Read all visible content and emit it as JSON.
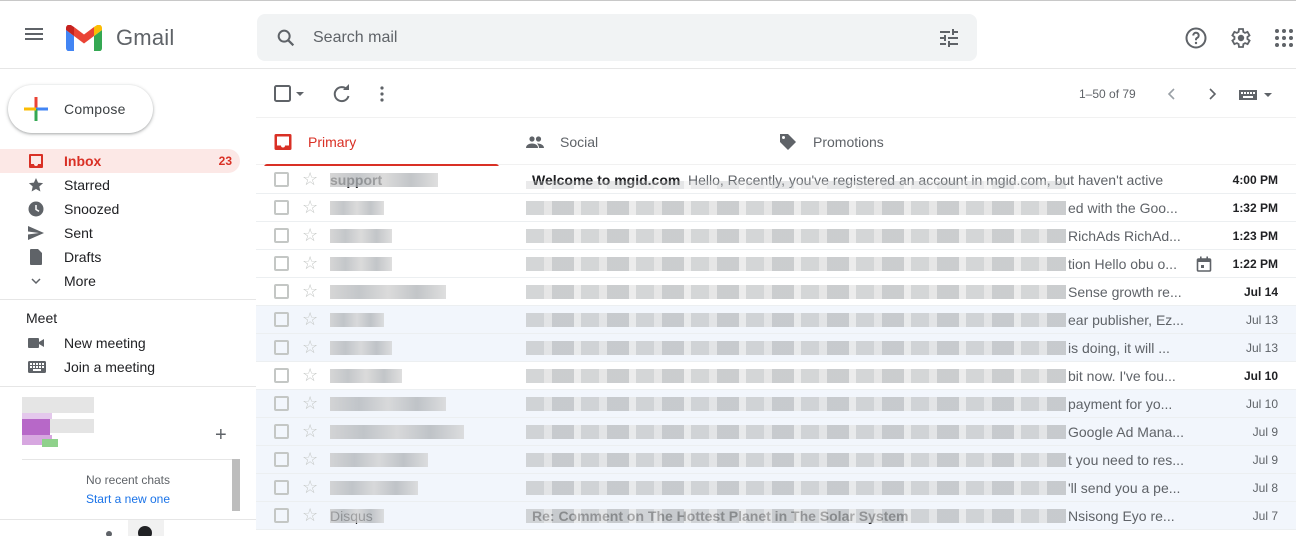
{
  "app": {
    "name": "Gmail"
  },
  "search": {
    "placeholder": "Search mail",
    "value": ""
  },
  "header_icons": [
    "help-icon",
    "settings-icon",
    "apps-icon"
  ],
  "compose": {
    "label": "Compose"
  },
  "nav": [
    {
      "label": "Inbox",
      "count": "23",
      "icon": "inbox-icon",
      "active": true
    },
    {
      "label": "Starred",
      "icon": "star-icon"
    },
    {
      "label": "Snoozed",
      "icon": "clock-icon"
    },
    {
      "label": "Sent",
      "icon": "send-icon"
    },
    {
      "label": "Drafts",
      "icon": "draft-icon"
    },
    {
      "label": "More",
      "icon": "chevron-down-icon"
    }
  ],
  "meet": {
    "title": "Meet",
    "items": [
      {
        "label": "New meeting",
        "icon": "video-icon"
      },
      {
        "label": "Join a meeting",
        "icon": "keyboard-icon"
      }
    ]
  },
  "chat": {
    "empty_text": "No recent chats",
    "start_link": "Start a new one"
  },
  "toolbar": {
    "pagination": "1–50 of 79"
  },
  "tabs": [
    {
      "label": "Primary",
      "icon": "inbox-icon",
      "active": true
    },
    {
      "label": "Social",
      "icon": "people-icon"
    },
    {
      "label": "Promotions",
      "icon": "tag-icon"
    }
  ],
  "emails": [
    {
      "sender": "support",
      "subject": "Welcome to mgid.com",
      "snippet": "Hello, Recently, you've registered an account in mgid.com, but haven't active",
      "date": "4:00 PM",
      "unread": true
    },
    {
      "sender": "",
      "snippet": "ed with the Goo...",
      "date": "1:32 PM",
      "unread": true
    },
    {
      "sender": "",
      "snippet": "RichAds RichAd...",
      "date": "1:23 PM",
      "unread": true
    },
    {
      "sender": "",
      "snippet": "tion Hello obu o...",
      "date": "1:22 PM",
      "unread": true,
      "calendar": true
    },
    {
      "sender": "",
      "snippet": "Sense growth re...",
      "date": "Jul 14",
      "unread": true
    },
    {
      "sender": "",
      "snippet": "ear publisher, Ez...",
      "date": "Jul 13",
      "unread": false
    },
    {
      "sender": "",
      "snippet": "is doing, it will ...",
      "date": "Jul 13",
      "unread": false
    },
    {
      "sender": "",
      "snippet": "bit now. I've fou...",
      "date": "Jul 10",
      "unread": true
    },
    {
      "sender": "",
      "snippet": "payment for yo...",
      "date": "Jul 10",
      "unread": false
    },
    {
      "sender": "",
      "snippet": "Google Ad Mana...",
      "date": "Jul 9",
      "unread": false
    },
    {
      "sender": "",
      "snippet": "t you need to res...",
      "date": "Jul 9",
      "unread": false
    },
    {
      "sender": "",
      "snippet": "'ll send you a pe...",
      "date": "Jul 8",
      "unread": false
    },
    {
      "sender": "Disqus",
      "subject": "Re: Comment on The Hottest Planet in The Solar System",
      "snippet": "Nsisong Eyo re...",
      "date": "Jul 7",
      "unread": false
    }
  ]
}
